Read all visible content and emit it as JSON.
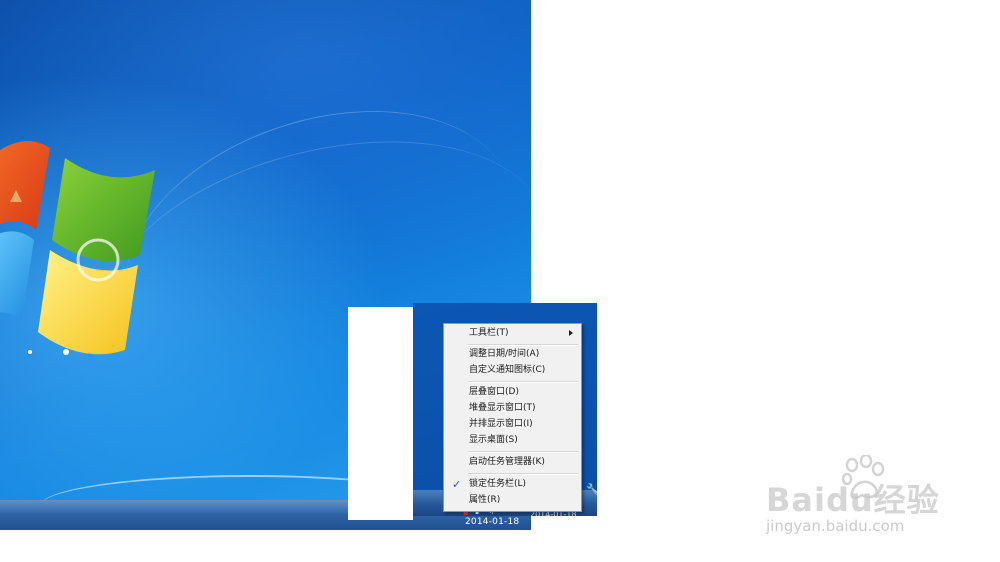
{
  "desktop": {
    "taskbar_date": "2014-01-18"
  },
  "overlay": {
    "tray_date": "2014-01-18"
  },
  "context_menu": {
    "items": [
      {
        "label": "工具栏(T)",
        "has_submenu": true
      },
      {
        "label": "调整日期/时间(A)"
      },
      {
        "label": "自定义通知图标(C)"
      },
      {
        "label": "层叠窗口(D)"
      },
      {
        "label": "堆叠显示窗口(T)"
      },
      {
        "label": "并排显示窗口(I)"
      },
      {
        "label": "显示桌面(S)"
      },
      {
        "label": "启动任务管理器(K)"
      },
      {
        "label": "锁定任务栏(L)",
        "checked": true
      },
      {
        "label": "属性(R)"
      }
    ]
  },
  "watermark": {
    "brand": "Baidu经验",
    "url": "jingyan.baidu.com"
  },
  "colors": {
    "desktop_blue": "#0b63c7",
    "menu_background": "#f1f1f1",
    "check_blue": "#1e56b3"
  }
}
